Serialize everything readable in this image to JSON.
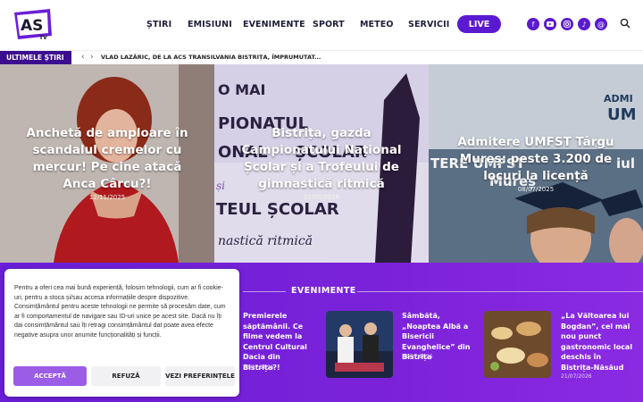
{
  "logo": {
    "text": "AS",
    "sub": "TV"
  },
  "nav": {
    "items": [
      "ȘTIRI",
      "EMISIUNI",
      "EVENIMENTE",
      "SPORT",
      "METEO",
      "SERVICII"
    ],
    "live": "LIVE"
  },
  "social": [
    "facebook-icon",
    "youtube-icon",
    "instagram-icon",
    "tiktok-icon",
    "threads-icon"
  ],
  "breaking": {
    "label": "ULTIMELE ȘTIRI",
    "prev": "‹",
    "next": "›",
    "headline": "VLAD LAZĂRIC, DE LA ACS TRANSILVANIA BISTRIȚA, ÎMPRUMUTAT..."
  },
  "hero": [
    {
      "title": "Anchetă de amploare în scandalul cremelor cu mercur! Pe cine atacă Anca Cârcu?!",
      "date": "12/11/2025"
    },
    {
      "title": "Bistrița, gazda Campionatului Național Școlar și a Trofeului de gimnastică ritmică",
      "date": "07/05/2026",
      "bg_text": [
        "O MAI",
        "PIONATUL",
        "ONAL",
        "ȘCOLAR",
        "și",
        "TEUL ȘCOLAR",
        "nastică ritmică"
      ]
    },
    {
      "title": "Admitere UMFST Târgu Mureș: peste 3.200 de locuri la licență",
      "date": "08/07/2025",
      "bg_text": [
        "ADMI",
        "UM",
        "TERE UMFST",
        "Mureș",
        "iul"
      ]
    }
  ],
  "events": {
    "title": "EVENIMENTE",
    "items": [
      {
        "title": "Premierele săptămânii. Ce filme vedem la Centrul Cultural Dacia din Bistrița?!",
        "date": "23/07/2026"
      },
      {
        "title": "Sâmbătă, „Noaptea Albă a Bisericii Evanghelice” din Bistrița",
        "date": "21/07/2026"
      },
      {
        "title": "„La Văltoarea lui Bogdan”, cel mai nou punct gastronomic local deschis în Bistrița-Năsăud",
        "date": "21/07/2026"
      }
    ]
  },
  "cookie": {
    "text": "Pentru a oferi cea mai bună experiență, folosim tehnologii, cum ar fi cookie-uri, pentru a stoca și/sau accesa informațiile despre dispozitive. Consimțământul pentru aceste tehnologii ne permite să procesăm date, cum ar fi comportamentul de navigare sau ID-uri unice pe acest site. Dacă nu îți dai consimțământul sau îți retragi consimțământul dat poate avea efecte negative asupra unor anumite funcționalități și funcții.",
    "accept": "ACCEPTĂ",
    "refuse": "REFUZĂ",
    "prefs": "VEZI PREFERINȚELE"
  },
  "colors": {
    "brand": "#5b1ad1",
    "breaking_bg": "#3b0d8f",
    "accept": "#9b5de5"
  }
}
